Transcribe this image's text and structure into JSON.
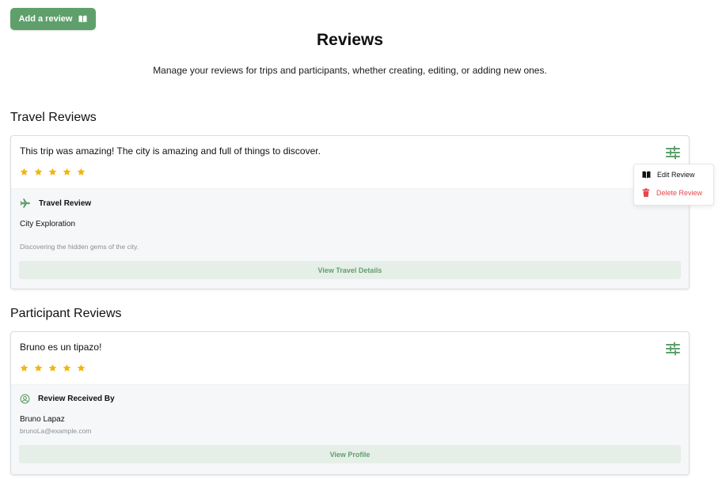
{
  "colors": {
    "accent": "#5f9f6c",
    "star": "#f5b50a",
    "danger": "#e5484d"
  },
  "header": {
    "add_review_label": "Add a review",
    "add_review_icon": "open-book-icon",
    "title": "Reviews",
    "description": "Manage your reviews for trips and participants, whether creating, editing, or adding new ones."
  },
  "travel_section": {
    "title": "Travel Reviews",
    "review": {
      "text": "This trip was amazing! The city is amazing and full of things to discover.",
      "rating": 5,
      "max_rating": 5,
      "settings_icon": "sliders-icon",
      "type_icon": "airplane-icon",
      "type_label": "Travel Review",
      "name": "City Exploration",
      "subtitle": "Discovering the hidden gems of the city.",
      "action_label": "View Travel Details"
    }
  },
  "menu": {
    "items": [
      {
        "label": "Edit Review",
        "icon": "open-book-icon"
      },
      {
        "label": "Delete Review",
        "icon": "trash-icon"
      }
    ]
  },
  "participant_section": {
    "title": "Participant Reviews",
    "review": {
      "text": "Bruno es un tipazo!",
      "rating": 5,
      "max_rating": 5,
      "settings_icon": "sliders-icon",
      "type_icon": "user-circle-icon",
      "type_label": "Review Received By",
      "name": "Bruno Lapaz",
      "subtitle": "brunoLa@example.com",
      "action_label": "View Profile"
    }
  }
}
